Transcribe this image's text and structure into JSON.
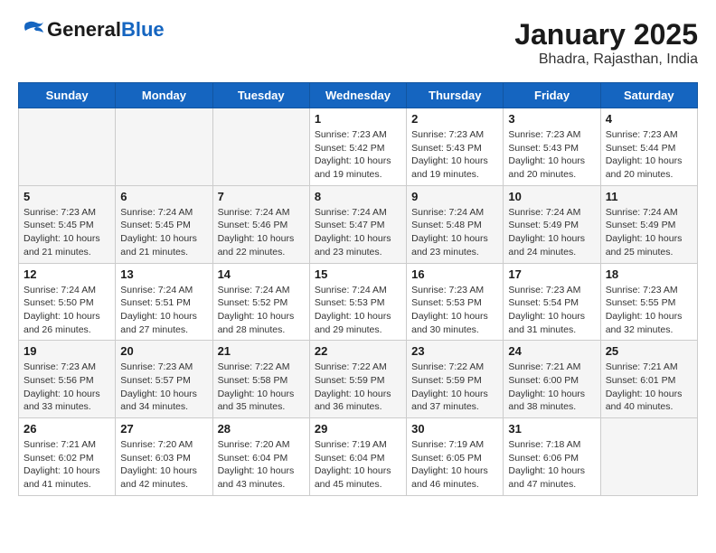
{
  "header": {
    "logo_general": "General",
    "logo_blue": "Blue",
    "title": "January 2025",
    "subtitle": "Bhadra, Rajasthan, India"
  },
  "weekdays": [
    "Sunday",
    "Monday",
    "Tuesday",
    "Wednesday",
    "Thursday",
    "Friday",
    "Saturday"
  ],
  "weeks": [
    [
      {
        "day": "",
        "sunrise": "",
        "sunset": "",
        "daylight": ""
      },
      {
        "day": "",
        "sunrise": "",
        "sunset": "",
        "daylight": ""
      },
      {
        "day": "",
        "sunrise": "",
        "sunset": "",
        "daylight": ""
      },
      {
        "day": "1",
        "sunrise": "Sunrise: 7:23 AM",
        "sunset": "Sunset: 5:42 PM",
        "daylight": "Daylight: 10 hours and 19 minutes."
      },
      {
        "day": "2",
        "sunrise": "Sunrise: 7:23 AM",
        "sunset": "Sunset: 5:43 PM",
        "daylight": "Daylight: 10 hours and 19 minutes."
      },
      {
        "day": "3",
        "sunrise": "Sunrise: 7:23 AM",
        "sunset": "Sunset: 5:43 PM",
        "daylight": "Daylight: 10 hours and 20 minutes."
      },
      {
        "day": "4",
        "sunrise": "Sunrise: 7:23 AM",
        "sunset": "Sunset: 5:44 PM",
        "daylight": "Daylight: 10 hours and 20 minutes."
      }
    ],
    [
      {
        "day": "5",
        "sunrise": "Sunrise: 7:23 AM",
        "sunset": "Sunset: 5:45 PM",
        "daylight": "Daylight: 10 hours and 21 minutes."
      },
      {
        "day": "6",
        "sunrise": "Sunrise: 7:24 AM",
        "sunset": "Sunset: 5:45 PM",
        "daylight": "Daylight: 10 hours and 21 minutes."
      },
      {
        "day": "7",
        "sunrise": "Sunrise: 7:24 AM",
        "sunset": "Sunset: 5:46 PM",
        "daylight": "Daylight: 10 hours and 22 minutes."
      },
      {
        "day": "8",
        "sunrise": "Sunrise: 7:24 AM",
        "sunset": "Sunset: 5:47 PM",
        "daylight": "Daylight: 10 hours and 23 minutes."
      },
      {
        "day": "9",
        "sunrise": "Sunrise: 7:24 AM",
        "sunset": "Sunset: 5:48 PM",
        "daylight": "Daylight: 10 hours and 23 minutes."
      },
      {
        "day": "10",
        "sunrise": "Sunrise: 7:24 AM",
        "sunset": "Sunset: 5:49 PM",
        "daylight": "Daylight: 10 hours and 24 minutes."
      },
      {
        "day": "11",
        "sunrise": "Sunrise: 7:24 AM",
        "sunset": "Sunset: 5:49 PM",
        "daylight": "Daylight: 10 hours and 25 minutes."
      }
    ],
    [
      {
        "day": "12",
        "sunrise": "Sunrise: 7:24 AM",
        "sunset": "Sunset: 5:50 PM",
        "daylight": "Daylight: 10 hours and 26 minutes."
      },
      {
        "day": "13",
        "sunrise": "Sunrise: 7:24 AM",
        "sunset": "Sunset: 5:51 PM",
        "daylight": "Daylight: 10 hours and 27 minutes."
      },
      {
        "day": "14",
        "sunrise": "Sunrise: 7:24 AM",
        "sunset": "Sunset: 5:52 PM",
        "daylight": "Daylight: 10 hours and 28 minutes."
      },
      {
        "day": "15",
        "sunrise": "Sunrise: 7:24 AM",
        "sunset": "Sunset: 5:53 PM",
        "daylight": "Daylight: 10 hours and 29 minutes."
      },
      {
        "day": "16",
        "sunrise": "Sunrise: 7:23 AM",
        "sunset": "Sunset: 5:53 PM",
        "daylight": "Daylight: 10 hours and 30 minutes."
      },
      {
        "day": "17",
        "sunrise": "Sunrise: 7:23 AM",
        "sunset": "Sunset: 5:54 PM",
        "daylight": "Daylight: 10 hours and 31 minutes."
      },
      {
        "day": "18",
        "sunrise": "Sunrise: 7:23 AM",
        "sunset": "Sunset: 5:55 PM",
        "daylight": "Daylight: 10 hours and 32 minutes."
      }
    ],
    [
      {
        "day": "19",
        "sunrise": "Sunrise: 7:23 AM",
        "sunset": "Sunset: 5:56 PM",
        "daylight": "Daylight: 10 hours and 33 minutes."
      },
      {
        "day": "20",
        "sunrise": "Sunrise: 7:23 AM",
        "sunset": "Sunset: 5:57 PM",
        "daylight": "Daylight: 10 hours and 34 minutes."
      },
      {
        "day": "21",
        "sunrise": "Sunrise: 7:22 AM",
        "sunset": "Sunset: 5:58 PM",
        "daylight": "Daylight: 10 hours and 35 minutes."
      },
      {
        "day": "22",
        "sunrise": "Sunrise: 7:22 AM",
        "sunset": "Sunset: 5:59 PM",
        "daylight": "Daylight: 10 hours and 36 minutes."
      },
      {
        "day": "23",
        "sunrise": "Sunrise: 7:22 AM",
        "sunset": "Sunset: 5:59 PM",
        "daylight": "Daylight: 10 hours and 37 minutes."
      },
      {
        "day": "24",
        "sunrise": "Sunrise: 7:21 AM",
        "sunset": "Sunset: 6:00 PM",
        "daylight": "Daylight: 10 hours and 38 minutes."
      },
      {
        "day": "25",
        "sunrise": "Sunrise: 7:21 AM",
        "sunset": "Sunset: 6:01 PM",
        "daylight": "Daylight: 10 hours and 40 minutes."
      }
    ],
    [
      {
        "day": "26",
        "sunrise": "Sunrise: 7:21 AM",
        "sunset": "Sunset: 6:02 PM",
        "daylight": "Daylight: 10 hours and 41 minutes."
      },
      {
        "day": "27",
        "sunrise": "Sunrise: 7:20 AM",
        "sunset": "Sunset: 6:03 PM",
        "daylight": "Daylight: 10 hours and 42 minutes."
      },
      {
        "day": "28",
        "sunrise": "Sunrise: 7:20 AM",
        "sunset": "Sunset: 6:04 PM",
        "daylight": "Daylight: 10 hours and 43 minutes."
      },
      {
        "day": "29",
        "sunrise": "Sunrise: 7:19 AM",
        "sunset": "Sunset: 6:04 PM",
        "daylight": "Daylight: 10 hours and 45 minutes."
      },
      {
        "day": "30",
        "sunrise": "Sunrise: 7:19 AM",
        "sunset": "Sunset: 6:05 PM",
        "daylight": "Daylight: 10 hours and 46 minutes."
      },
      {
        "day": "31",
        "sunrise": "Sunrise: 7:18 AM",
        "sunset": "Sunset: 6:06 PM",
        "daylight": "Daylight: 10 hours and 47 minutes."
      },
      {
        "day": "",
        "sunrise": "",
        "sunset": "",
        "daylight": ""
      }
    ]
  ]
}
